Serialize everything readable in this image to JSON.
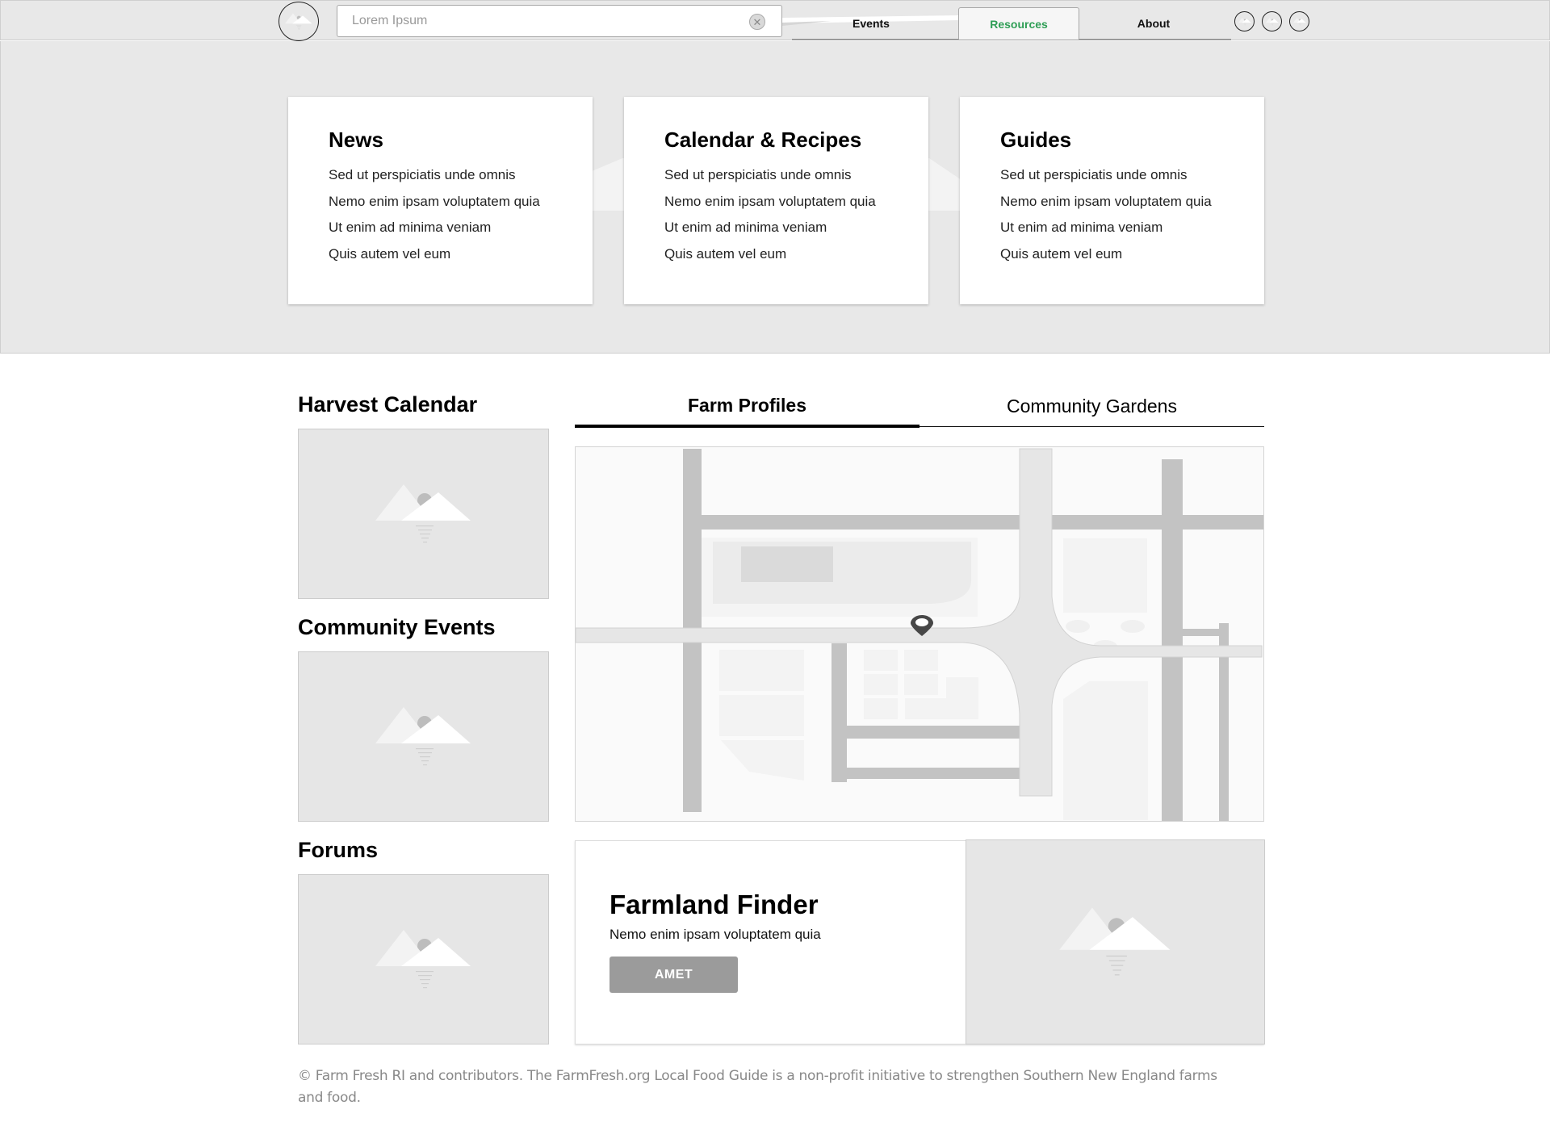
{
  "header": {
    "logo_icon": "image-placeholder-icon",
    "search": {
      "value": "",
      "placeholder": "Lorem Ipsum",
      "clear_icon": "clear-circle-x-icon"
    },
    "nav": [
      {
        "label": "Events",
        "active": false
      },
      {
        "label": "Resources",
        "active": true
      },
      {
        "label": "About",
        "active": false
      }
    ],
    "icon_buttons": [
      "image-placeholder-icon",
      "image-placeholder-icon",
      "image-placeholder-icon"
    ],
    "accent_color": "#2e9e55"
  },
  "hero": {
    "cards": [
      {
        "title": "News",
        "items": [
          "Sed ut perspiciatis unde omnis",
          "Nemo enim ipsam voluptatem quia",
          "Ut enim ad minima veniam",
          "Quis autem vel eum"
        ]
      },
      {
        "title": "Calendar & Recipes",
        "items": [
          "Sed ut perspiciatis unde omnis",
          "Nemo enim ipsam voluptatem quia",
          "Ut enim ad minima veniam",
          "Quis autem vel eum"
        ]
      },
      {
        "title": "Guides",
        "items": [
          "Sed ut perspiciatis unde omnis",
          "Nemo enim ipsam voluptatem quia",
          "Ut enim ad minima veniam",
          "Quis autem vel eum"
        ]
      }
    ]
  },
  "sidebar": {
    "sections": [
      {
        "title": "Harvest Calendar",
        "image_icon": "image-placeholder-icon"
      },
      {
        "title": "Community Events",
        "image_icon": "image-placeholder-icon"
      },
      {
        "title": "Forums",
        "image_icon": "image-placeholder-icon"
      }
    ]
  },
  "main": {
    "tabs": [
      {
        "label": "Farm Profiles",
        "active": true
      },
      {
        "label": "Community Gardens",
        "active": false
      }
    ],
    "map": {
      "marker_icon": "map-pin-icon"
    },
    "finder": {
      "title": "Farmland Finder",
      "description": "Nemo enim ipsam voluptatem quia",
      "button_label": "AMET",
      "image_icon": "image-placeholder-icon"
    }
  },
  "footer": {
    "text": "© Farm Fresh RI and contributors. The FarmFresh.org Local Food Guide is a non-profit initiative to strengthen Southern New England farms and food."
  }
}
